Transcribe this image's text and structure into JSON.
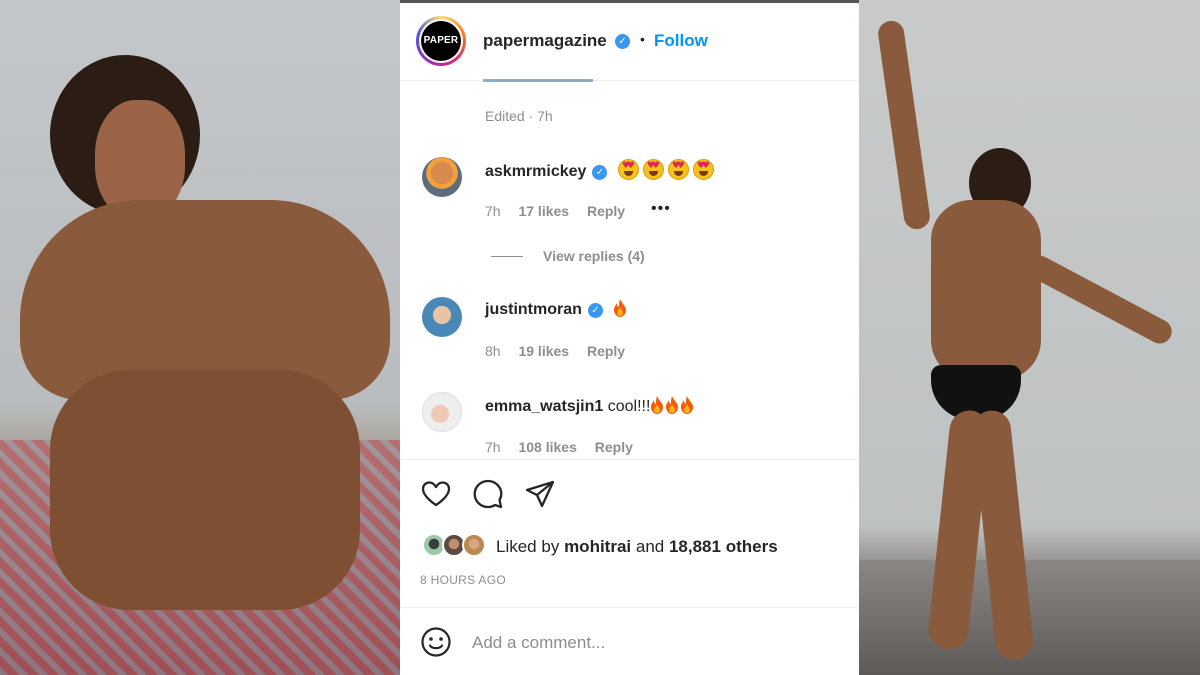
{
  "post": {
    "account": {
      "username": "papermagazine",
      "avatar_text": "PAPER",
      "verified": true,
      "separator": "•",
      "follow_label": "Follow"
    },
    "caption_meta": "Edited · 7h",
    "comments": [
      {
        "username": "askmrmickey",
        "verified": true,
        "text": "😍😍😍😍",
        "time": "7h",
        "likes": "17 likes",
        "reply_label": "Reply",
        "more_label": "•••",
        "view_replies": "View replies (4)"
      },
      {
        "username": "justintmoran",
        "verified": true,
        "text": "🔥",
        "time": "8h",
        "likes": "19 likes",
        "reply_label": "Reply"
      },
      {
        "username": "emma_watsjin1",
        "verified": false,
        "text": "cool!!!🔥🔥🔥",
        "text_word": "cool!!!",
        "time": "7h",
        "likes": "108 likes",
        "reply_label": "Reply"
      }
    ],
    "likes": {
      "prefix": "Liked by",
      "user": "mohitrai",
      "middle": "and",
      "others": "18,881 others"
    },
    "timestamp": "8 HOURS AGO",
    "add_comment": {
      "placeholder": "Add a comment..."
    }
  },
  "icons": {
    "verified": "verified-badge-icon",
    "like": "heart-icon",
    "comment": "comment-bubble-icon",
    "share": "paper-plane-icon",
    "emoji": "smile-icon"
  },
  "colors": {
    "link_blue": "#0095f6",
    "verified_blue": "#3897f0",
    "muted_text": "#8e8e8e",
    "primary_text": "#262626"
  }
}
